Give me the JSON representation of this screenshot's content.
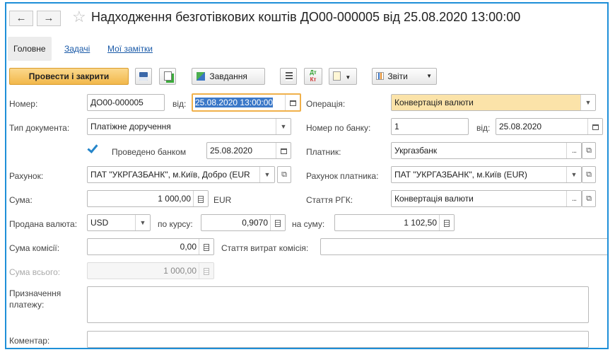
{
  "window": {
    "title": "Надходження безготівкових коштів ДО00-000005 від 25.08.2020 13:00:00"
  },
  "nav": {
    "back_icon": "←",
    "forward_icon": "→",
    "star_icon": "☆"
  },
  "tabs": [
    {
      "label": "Головне"
    },
    {
      "label": "Задачі"
    },
    {
      "label": "Мої замітки"
    }
  ],
  "toolbar": {
    "post_close_label": "Провести і закрити",
    "tasks_label": "Завдання",
    "reports_label": "Звіти",
    "dtkt_top": "Дт",
    "dtkt_bottom": "Кт"
  },
  "form": {
    "number_label": "Номер:",
    "number_value": "ДО00-000005",
    "from_label": "від:",
    "date_value": "25.08.2020 13:00:00",
    "operation_label": "Операція:",
    "operation_value": "Конвертація валюти",
    "doc_type_label": "Тип документа:",
    "doc_type_value": "Платіжне доручення",
    "bank_number_label": "Номер по банку:",
    "bank_number_value": "1",
    "bank_from_label": "від:",
    "bank_date_value": "25.08.2020",
    "bank_posted_label": "Проведено банком",
    "bank_posted_checked": true,
    "bank_posted_date": "25.08.2020",
    "payer_label": "Платник:",
    "payer_value": "Укргазбанк",
    "account_label": "Рахунок:",
    "account_value": "ПАТ \"УКРГАЗБАНК\", м.Київ, Добро (EUR",
    "payer_account_label": "Рахунок платника:",
    "payer_account_value": "ПАТ \"УКРГАЗБАНК\", м.Київ (EUR)",
    "sum_label": "Сума:",
    "sum_value": "1 000,00",
    "sum_currency": "EUR",
    "rgk_label": "Стаття РГК:",
    "rgk_value": "Конвертація валюти",
    "sold_currency_label": "Продана валюта:",
    "sold_currency_value": "USD",
    "rate_label": "по курсу:",
    "rate_value": "0,9070",
    "for_sum_label": "на суму:",
    "for_sum_value": "1 102,50",
    "commission_label": "Сума комісії:",
    "commission_value": "0,00",
    "commission_article_label": "Стаття витрат комісія:",
    "commission_article_value": "",
    "total_label": "Сума всього:",
    "total_value": "1 000,00",
    "purpose_label_1": "Призначення",
    "purpose_label_2": "платежу:",
    "purpose_value": "",
    "comment_label": "Коментар:",
    "comment_value": ""
  },
  "colors": {
    "accent_border": "#1e8fd8",
    "primary_button": "#f2b84b",
    "highlight_field": "#fbe3a9",
    "link": "#1a5aa8"
  }
}
